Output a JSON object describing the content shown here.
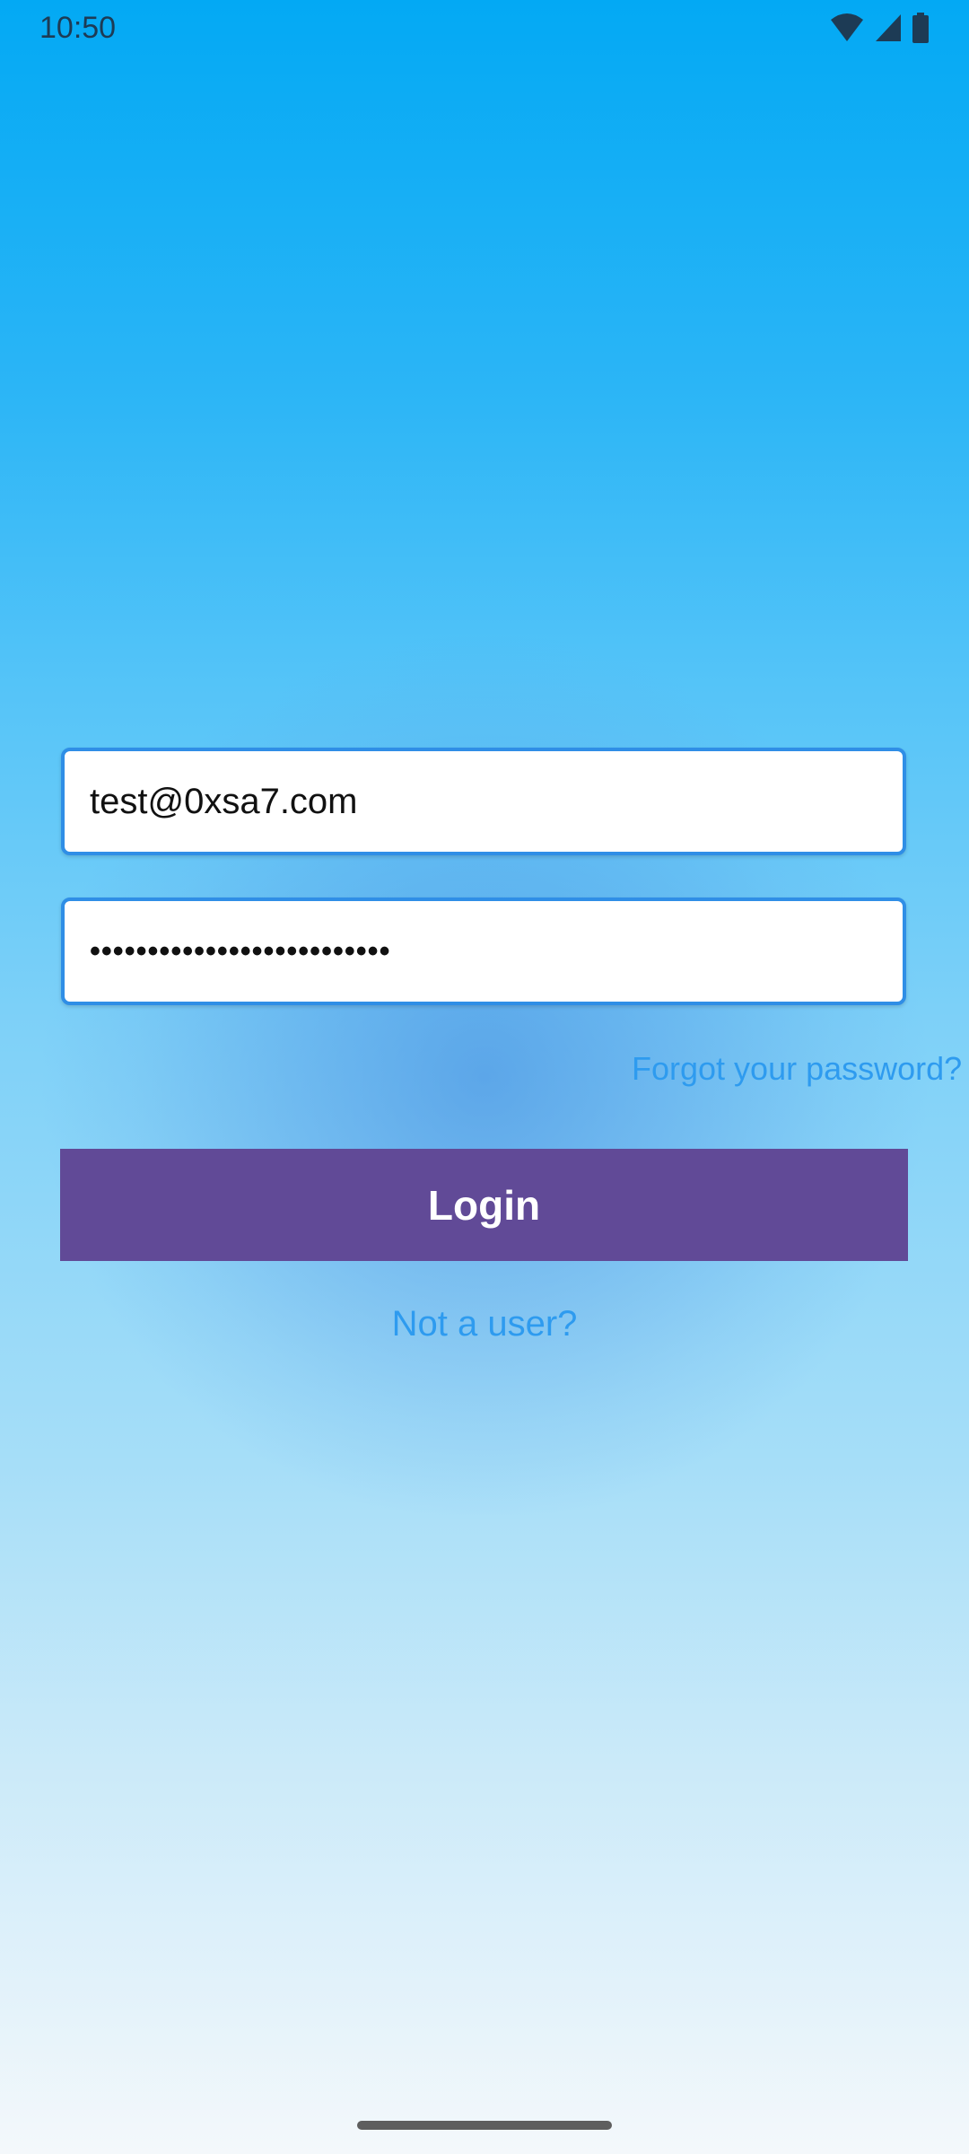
{
  "status_bar": {
    "time": "10:50",
    "icons": [
      "wifi-icon",
      "cellular-signal-icon",
      "battery-icon"
    ]
  },
  "login_form": {
    "email_value": "test@0xsa7.com",
    "password_value": "••••••••••••••••••••••••••",
    "forgot_password_label": "Forgot your password?",
    "login_button_label": "Login",
    "signup_label": "Not a user?"
  },
  "colors": {
    "accent_link": "#2e9bef",
    "button_background": "#614a97",
    "field_border": "#2f8ee6",
    "gradient_top": "#03a9f4",
    "gradient_bottom": "#f4f8fb"
  }
}
